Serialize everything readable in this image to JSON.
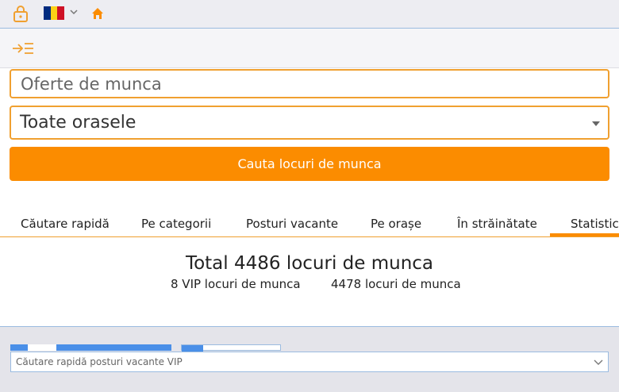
{
  "topbar": {
    "lock_icon": "lock-icon",
    "flag_colors": [
      "#002b7f",
      "#fcd116",
      "#ce1126"
    ],
    "home_icon": "home-icon",
    "accent": "#f0a030"
  },
  "navbar": {
    "menu_icon": "menu-collapse-icon"
  },
  "search": {
    "placeholder": "Oferte de munca",
    "city_value": "Toate orasele",
    "button_label": "Cauta locuri de munca",
    "button_color": "#fb8c00"
  },
  "tabs": [
    {
      "label": "Căutare rapidă",
      "active": false
    },
    {
      "label": "Pe categorii",
      "active": false
    },
    {
      "label": "Posturi vacante",
      "active": false
    },
    {
      "label": "Pe orașe",
      "active": false
    },
    {
      "label": "În străinătate",
      "active": false
    },
    {
      "label": "Statistica",
      "active": true
    }
  ],
  "stats": {
    "total": "Total 4486 locuri de munca",
    "vip": "8 VIP locuri de munca",
    "regular": "4478 locuri de munca"
  },
  "bottom": {
    "vip_select_value": "Căutare rapidă posturi vacante VIP"
  }
}
